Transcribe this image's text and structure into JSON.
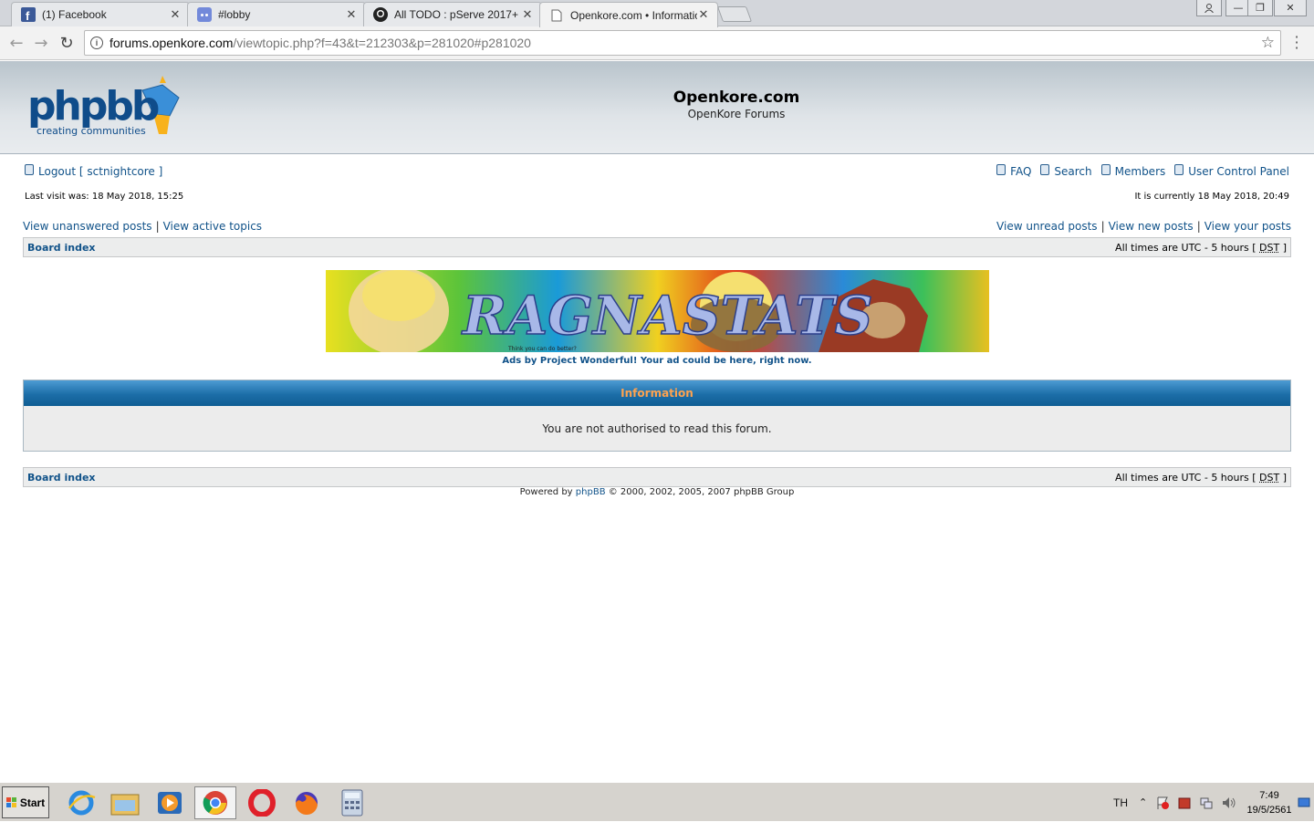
{
  "browser": {
    "tabs": [
      {
        "title": "(1) Facebook",
        "icon": "facebook-icon",
        "active": false
      },
      {
        "title": "#lobby",
        "icon": "discord-icon",
        "active": false
      },
      {
        "title": "All TODO : pServe 2017+",
        "icon": "github-icon",
        "active": false
      },
      {
        "title": "Openkore.com • Informatio",
        "icon": "page-icon",
        "active": true
      }
    ],
    "url_host": "forums.openkore.com",
    "url_path": "/viewtopic.php?f=43&t=212303&p=281020#p281020"
  },
  "forum": {
    "logo_text": "phpbb",
    "logo_tagline": "creating communities",
    "site_title": "Openkore.com",
    "site_description": "OpenKore Forums",
    "logout": "Logout [ sctnightcore ]",
    "menu": {
      "faq": "FAQ",
      "search": "Search",
      "members": "Members",
      "ucp": "User Control Panel"
    },
    "last_visit": "Last visit was: 18 May 2018, 15:25",
    "current_time": "It is currently 18 May 2018, 20:49",
    "links_left": [
      "View unanswered posts",
      "View active topics"
    ],
    "links_right": [
      "View unread posts",
      "View new posts",
      "View your posts"
    ],
    "board_index": "Board index",
    "timezone_prefix": "All times are UTC - 5 hours [",
    "timezone_dst": "DST",
    "timezone_suffix": "]",
    "banner_text": "RAGNASTATS",
    "banner_tagline": "Think you can do better?",
    "ad_line": "Ads by Project Wonderful! Your ad could be here, right now.",
    "info_title": "Information",
    "info_message": "You are not authorised to read this forum.",
    "powered_prefix": "Powered by",
    "powered_link": "phpBB",
    "powered_suffix": "© 2000, 2002, 2005, 2007 phpBB Group"
  },
  "taskbar": {
    "start_label": "Start",
    "lang": "TH",
    "time": "7:49",
    "date": "19/5/2561"
  },
  "colors": {
    "link": "#105289",
    "info_header": "#1c6ea8",
    "info_title_text": "#ffa34f"
  }
}
